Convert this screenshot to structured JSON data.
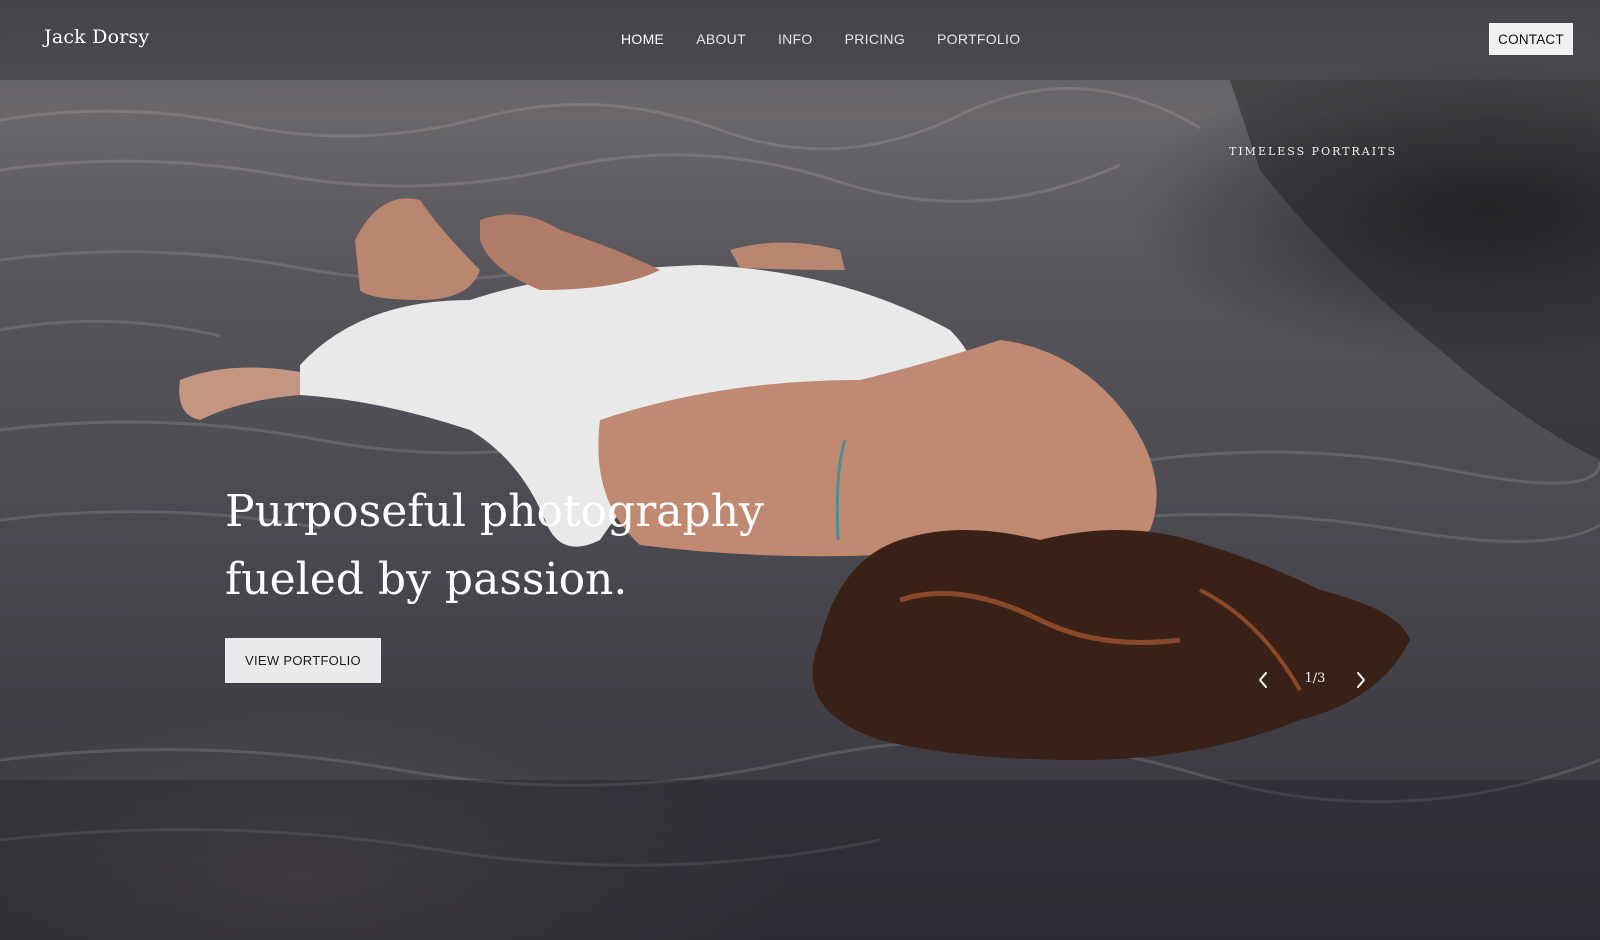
{
  "header": {
    "brand": "Jack Dorsy",
    "nav": [
      {
        "label": "HOME",
        "active": true
      },
      {
        "label": "ABOUT",
        "active": false
      },
      {
        "label": "INFO",
        "active": false
      },
      {
        "label": "PRICING",
        "active": false
      },
      {
        "label": "PORTFOLIO",
        "active": false
      }
    ],
    "contact_label": "CONTACT"
  },
  "hero": {
    "tagline": "TIMELESS PORTRAITS",
    "headline_line1": "Purposeful photography",
    "headline_line2": "fueled by passion.",
    "cta_label": "VIEW PORTFOLIO",
    "image_description_icon": "hero-photo",
    "slider": {
      "counter": "1/3",
      "prev_icon": "chevron-left-icon",
      "next_icon": "chevron-right-icon"
    }
  },
  "colors": {
    "button_bg": "#e9eaec",
    "contact_bg": "#f0f0f0",
    "text": "#ffffff"
  }
}
